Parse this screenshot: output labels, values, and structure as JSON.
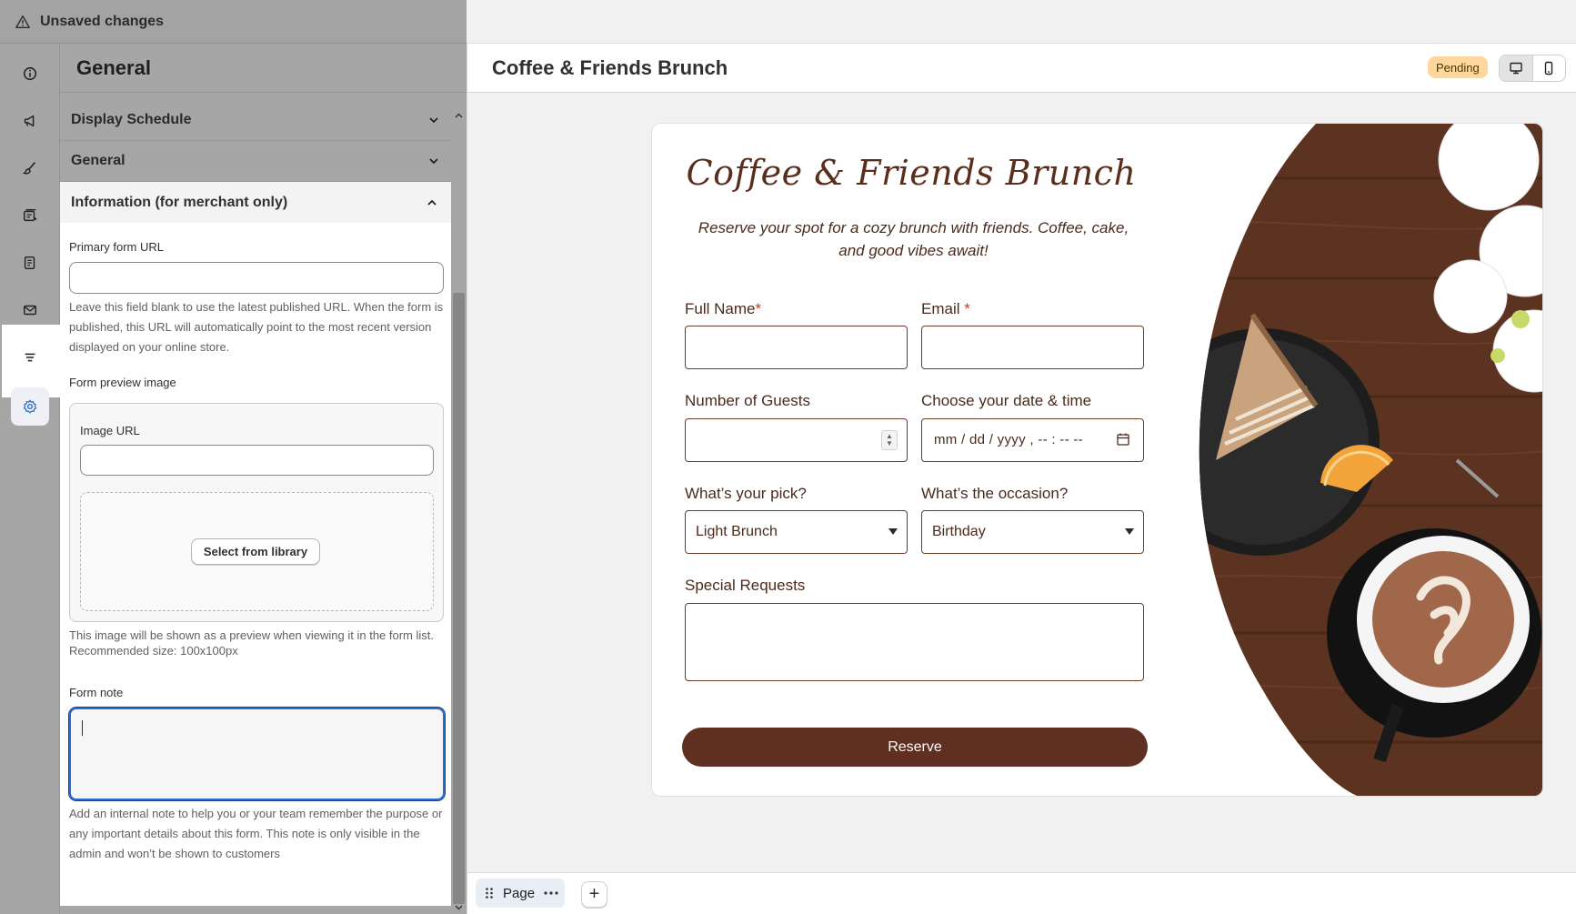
{
  "topbar": {
    "status_text": "Unsaved changes"
  },
  "sidebar": {
    "section_title": "General",
    "rail_icons": [
      "info-icon",
      "megaphone-icon",
      "brush-icon",
      "form-stack-icon",
      "receipt-icon",
      "mail-icon",
      "filter-lines-icon",
      "gear-icon"
    ],
    "accordions": [
      {
        "label": "Display Schedule"
      },
      {
        "label": "General"
      },
      {
        "label": "Information (for merchant only)"
      }
    ],
    "primary_url": {
      "label": "Primary form URL",
      "value": "",
      "help": "Leave this field blank to use the latest published URL. When the form is published, this URL will automatically point to the most recent version displayed on your online store."
    },
    "preview_image": {
      "label": "Form preview image",
      "url_label": "Image URL",
      "url_value": "",
      "select_button": "Select from library",
      "help": "This image will be shown as a preview when viewing it in the form list. Recommended size: 100x100px"
    },
    "form_note": {
      "label": "Form note",
      "value": "",
      "help": "Add an internal note to help you or your team remember the purpose or any important details about this form. This note is only visible in the admin and won’t be shown to customers"
    }
  },
  "preview": {
    "title": "Coffee & Friends Brunch",
    "status_badge": "Pending",
    "device_modes": [
      "desktop-icon",
      "mobile-icon"
    ],
    "active_device": "desktop"
  },
  "form": {
    "brand_title": "Coffee & Friends Brunch",
    "subtitle": "Reserve your spot for a cozy brunch with friends. Coffee, cake, and good vibes await!",
    "fields": {
      "full_name": {
        "label": "Full Name",
        "required_mark": "*"
      },
      "email": {
        "label": "Email ",
        "required_mark": "*"
      },
      "guests": {
        "label": "Number of Guests"
      },
      "datetime": {
        "label": "Choose your date & time",
        "placeholder": "mm / dd / yyyy ,  -- : --   --"
      },
      "pick": {
        "label": "What’s your pick?",
        "selected": "Light Brunch"
      },
      "occasion": {
        "label": "What’s the occasion?",
        "selected": "Birthday"
      },
      "requests": {
        "label": "Special Requests"
      }
    },
    "submit_label": "Reserve",
    "colors": {
      "brand": "#5f3021",
      "text": "#4a2a1c",
      "wood": "#5b3320"
    }
  },
  "bottom_bar": {
    "page_tab": "Page",
    "add_label": "+"
  }
}
